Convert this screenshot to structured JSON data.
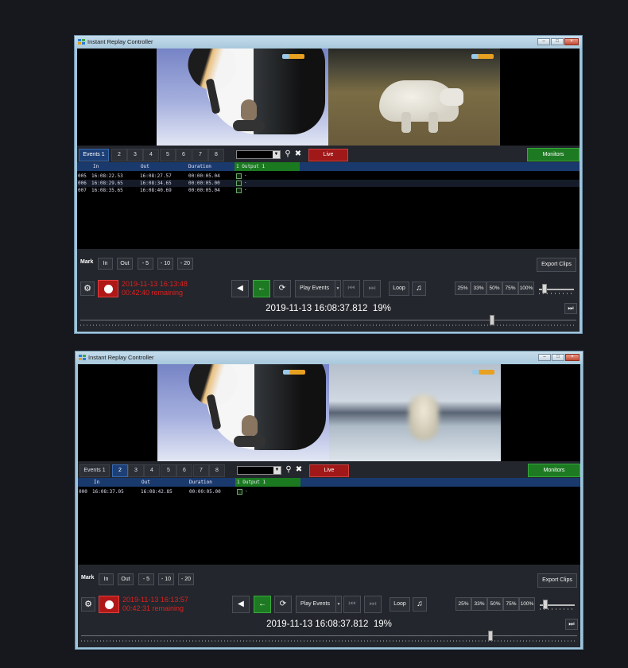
{
  "colors": {
    "background": "#16181e",
    "panel": "#23262c",
    "active_tab": "#1c3f76",
    "live": "#a01818",
    "green": "#1d7a22",
    "record_text": "#e02020"
  },
  "icons": {
    "settings": "gear-icon",
    "record": "record-icon",
    "back": "arrow-left-icon",
    "undo": "rotate-icon",
    "skip_prev": "skip-back-icon",
    "skip_next": "skip-forward-icon",
    "audio": "music-note-icon",
    "search": "search-icon",
    "close": "close-icon",
    "skip_end": "skip-end-icon"
  },
  "windows": [
    {
      "title": "Instant Replay Controller",
      "tabs": [
        "Events 1",
        "2",
        "3",
        "4",
        "5",
        "6",
        "7",
        "8"
      ],
      "active_tab": 0,
      "live_label": "Live",
      "monitors_label": "Monitors",
      "columns": {
        "in": "In",
        "out": "Out",
        "duration": "Duration",
        "output": "1 Output 1"
      },
      "events": [
        {
          "id": "005",
          "in": "16:08:22.53",
          "out": "16:08:27.57",
          "duration": "00:00:05.04",
          "mark": "-"
        },
        {
          "id": "006",
          "in": "16:08:29.65",
          "out": "16:08:34.65",
          "duration": "00:00:05.00",
          "mark": "-"
        },
        {
          "id": "007",
          "in": "16:08:35.65",
          "out": "16:08:40.69",
          "duration": "00:00:05.04",
          "mark": "-"
        }
      ],
      "mark_label": "Mark",
      "mark_buttons": [
        "In",
        "Out",
        "- 5",
        "- 10",
        "- 20"
      ],
      "export_label": "Export Clips",
      "record_time": "2019-11-13 16:13:48",
      "record_remaining": "00:42:40 remaining",
      "play_events_label": "Play Events",
      "loop_label": "Loop",
      "zoom_levels": [
        "25%",
        "33%",
        "50%",
        "75%",
        "100%"
      ],
      "timecode": "2019-11-13 16:08:37.812",
      "progress_label": "19%",
      "timeline_position": 0.83,
      "zoom_slider_position": 0.15
    },
    {
      "title": "Instant Replay Controller",
      "tabs": [
        "Events 1",
        "2",
        "3",
        "4",
        "5",
        "6",
        "7",
        "8"
      ],
      "active_tab": 1,
      "live_label": "Live",
      "monitors_label": "Monitors",
      "columns": {
        "in": "In",
        "out": "Out",
        "duration": "Duration",
        "output": "1 Output 1"
      },
      "events": [
        {
          "id": "000",
          "in": "16:08:37.05",
          "out": "16:08:42.85",
          "duration": "00:00:05.00",
          "mark": "-"
        }
      ],
      "mark_label": "Mark",
      "mark_buttons": [
        "In",
        "Out",
        "- 5",
        "- 10",
        "- 20"
      ],
      "export_label": "Export Clips",
      "record_time": "2019-11-13 16:13:57",
      "record_remaining": "00:42:31 remaining",
      "play_events_label": "Play Events",
      "loop_label": "Loop",
      "zoom_levels": [
        "25%",
        "33%",
        "50%",
        "75%",
        "100%"
      ],
      "timecode": "2019-11-13 16:08:37.812",
      "progress_label": "19%",
      "timeline_position": 0.825,
      "zoom_slider_position": 0.15
    }
  ]
}
